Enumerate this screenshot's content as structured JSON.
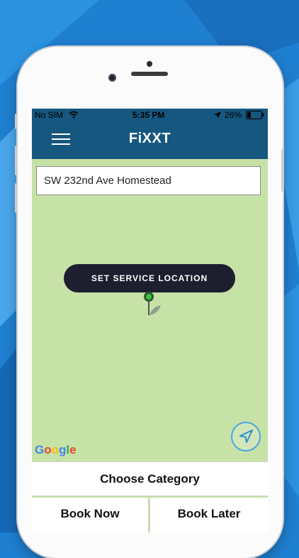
{
  "status_bar": {
    "carrier": "No SIM",
    "time": "5:35 PM",
    "battery": "26%",
    "battery_level": 0.26
  },
  "header": {
    "title": "FiXXT"
  },
  "map": {
    "address_value": "SW 232nd Ave Homestead",
    "set_location_label": "SET SERVICE LOCATION",
    "provider_logo": "Google"
  },
  "actions": {
    "choose_category": "Choose Category",
    "book_now": "Book Now",
    "book_later": "Book Later"
  },
  "icons": [
    "wifi-icon",
    "location-arrow-icon",
    "battery-icon",
    "hamburger-menu-icon",
    "map-pin-icon",
    "locate-me-icon"
  ],
  "colors": {
    "header": "#16577f",
    "map": "#c7e2a7",
    "button_dark": "#1d1f2e",
    "accent_blue": "#4aa6e4"
  }
}
